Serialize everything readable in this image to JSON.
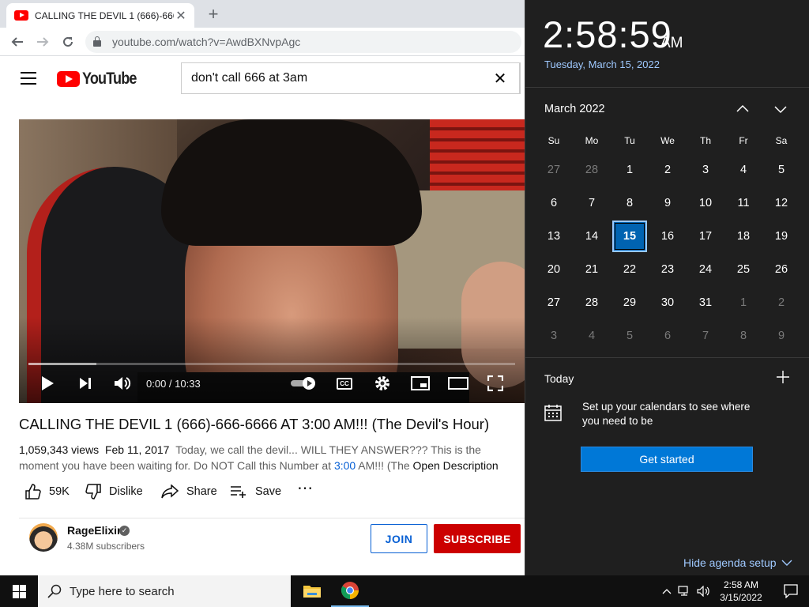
{
  "browser": {
    "tab_title": "CALLING THE DEVIL 1 (666)-666-",
    "url": "youtube.com/watch?v=AwdBXNvpAgc"
  },
  "youtube": {
    "logo_text": "YouTube",
    "search_query": "don't call 666 at 3am",
    "player": {
      "time": "0:00 / 10:33",
      "progress_fraction": 0.0,
      "buffered_fraction": 0.14
    },
    "video_title": "CALLING THE DEVIL 1 (666)-666-6666 AT 3:00 AM!!! (The Devil's Hour)",
    "views": "1,059,343 views",
    "date": "Feb 11, 2017",
    "description_line1": "Today, we call the devil... WILL THEY ANSWER??? This is the",
    "description_line2_a": "moment you have been waiting for. Do NOT Call this Number at ",
    "description_link": "3:00",
    "description_line2_b": " AM!!! (The ",
    "open_description": "Open Description",
    "actions": {
      "likes": "59K",
      "dislike": "Dislike",
      "share": "Share",
      "save": "Save"
    },
    "channel": {
      "name": "RageElixir",
      "subscribers": "4.38M subscribers",
      "join_label": "JOIN",
      "subscribe_label": "SUBSCRIBE"
    }
  },
  "clock_flyout": {
    "time": "2:58:59",
    "ampm": "AM",
    "date_long": "Tuesday, March 15, 2022",
    "month_label": "March 2022",
    "weekdays": [
      "Su",
      "Mo",
      "Tu",
      "We",
      "Th",
      "Fr",
      "Sa"
    ],
    "weeks": [
      [
        "27",
        "28",
        "1",
        "2",
        "3",
        "4",
        "5"
      ],
      [
        "6",
        "7",
        "8",
        "9",
        "10",
        "11",
        "12"
      ],
      [
        "13",
        "14",
        "15",
        "16",
        "17",
        "18",
        "19"
      ],
      [
        "20",
        "21",
        "22",
        "23",
        "24",
        "25",
        "26"
      ],
      [
        "27",
        "28",
        "29",
        "30",
        "31",
        "1",
        "2"
      ],
      [
        "3",
        "4",
        "5",
        "6",
        "7",
        "8",
        "9"
      ]
    ],
    "today_label": "Today",
    "agenda_message": "Set up your calendars to see where you need to be",
    "get_started_label": "Get started",
    "hide_agenda_label": "Hide agenda setup"
  },
  "taskbar": {
    "search_placeholder": "Type here to search",
    "time": "2:58 AM",
    "date": "3/15/2022"
  },
  "colors": {
    "youtube_red": "#ff0000",
    "subscribe_red": "#cc0000",
    "link_blue": "#065fd4",
    "today_highlight": "#0063b1",
    "accent_button": "#0078d7",
    "flyout_bg": "#1f1f1f"
  }
}
